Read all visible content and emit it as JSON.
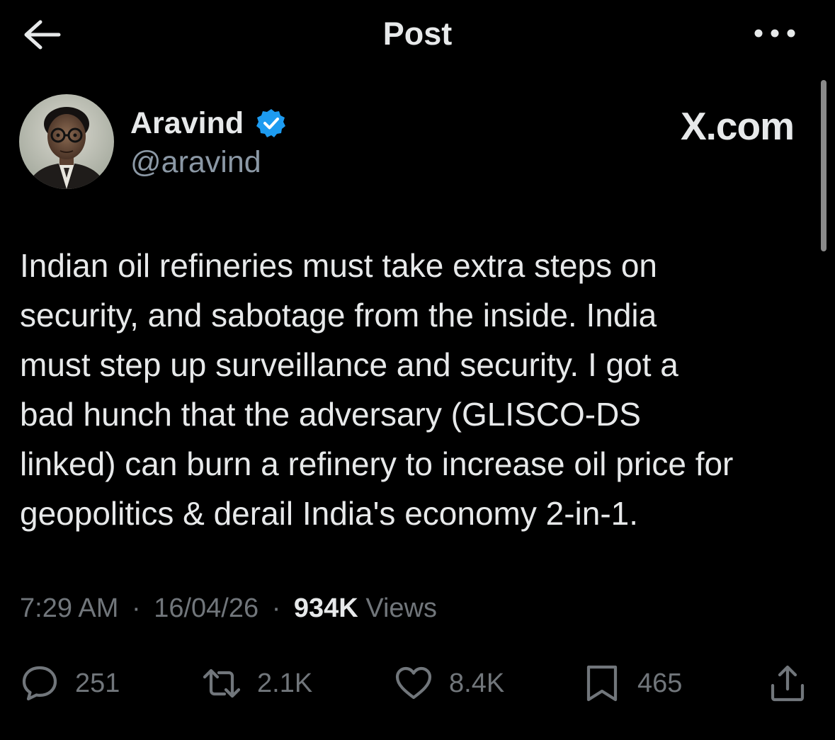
{
  "header": {
    "title": "Post"
  },
  "author": {
    "name": "Aravind",
    "handle": "@aravind",
    "verified": true,
    "verified_color": "#1d9bf0"
  },
  "watermark": "X.com",
  "post": {
    "lines": [
      "Indian oil refineries must take extra steps on",
      "security, and sabotage from the inside. India",
      "must step up surveillance and security. I got a",
      "bad hunch that the adversary (GLISCO-DS",
      "linked) can burn a refinery to increase oil price for",
      "geopolitics & derail India's economy 2-in-1."
    ]
  },
  "meta": {
    "time": "7:29 AM",
    "date": "16/04/26",
    "views_count": "934K",
    "views_label": "Views",
    "separator": "·"
  },
  "actions": {
    "replies": "251",
    "reposts": "2.1K",
    "likes": "8.4K",
    "bookmarks": "465"
  },
  "icons": {
    "back": "arrow-left-icon",
    "more": "more-horizontal-icon",
    "reply": "reply-icon",
    "repost": "repost-icon",
    "like": "heart-icon",
    "bookmark": "bookmark-icon",
    "share": "share-icon"
  },
  "colors": {
    "background": "#000000",
    "text": "#e7e9ea",
    "secondary": "#71767b",
    "accent": "#1d9bf0"
  }
}
